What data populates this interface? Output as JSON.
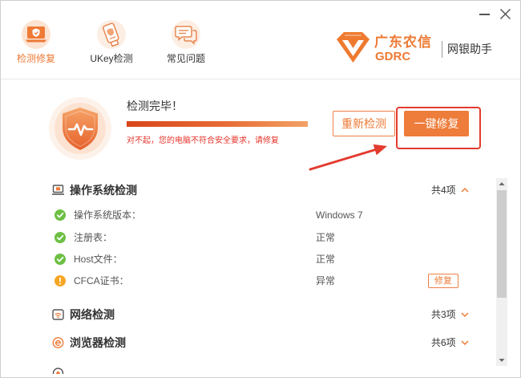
{
  "window": {
    "minimize_icon": "minimize-icon",
    "close_icon": "close-icon"
  },
  "nav": {
    "tabs": [
      {
        "label": "检测修复",
        "icon": "shield-monitor-icon",
        "active": true
      },
      {
        "label": "UKey检测",
        "icon": "ukey-icon",
        "active": false
      },
      {
        "label": "常见问题",
        "icon": "faq-chat-icon",
        "active": false
      }
    ]
  },
  "brand": {
    "logo_icon": "gdrc-logo-icon",
    "name_cn": "广东农信",
    "name_en": "GDRC",
    "product": "网银助手"
  },
  "status": {
    "badge_icon": "shield-heartbeat-icon",
    "title": "检测完毕！",
    "progress": 1.0,
    "message": "对不起，您的电脑不符合安全要求，请修复",
    "rescan_label": "重新检测",
    "repair_all_label": "一键修复"
  },
  "sections": [
    {
      "title": "操作系统检测",
      "count": "共4项",
      "icon": "computer-icon",
      "expanded": true,
      "items": [
        {
          "label": "操作系统版本：",
          "value": "Windows 7",
          "icon": "check-circle-icon"
        },
        {
          "label": "注册表：",
          "value": "正常",
          "icon": "check-circle-icon"
        },
        {
          "label": "Host文件：",
          "value": "正常",
          "icon": "check-circle-icon"
        },
        {
          "label": "CFCA证书：",
          "value": "异常",
          "icon": "warning-circle-icon",
          "fix_label": "修复"
        }
      ]
    },
    {
      "title": "网络检测",
      "count": "共3项",
      "icon": "network-icon",
      "expanded": false
    },
    {
      "title": "浏览器检测",
      "count": "共6项",
      "icon": "browser-icon",
      "expanded": false
    },
    {
      "icon": "plugin-icon",
      "expanded": false
    }
  ],
  "scrollbar": {
    "up_icon": "scroll-up-arrow-icon",
    "down_icon": "scroll-down-arrow-icon"
  },
  "colors": {
    "accent": "#ed7a35",
    "ok": "#6cbf43",
    "warn": "#f5a623",
    "error_text": "#e6352b",
    "annotation": "#e33b2e"
  }
}
